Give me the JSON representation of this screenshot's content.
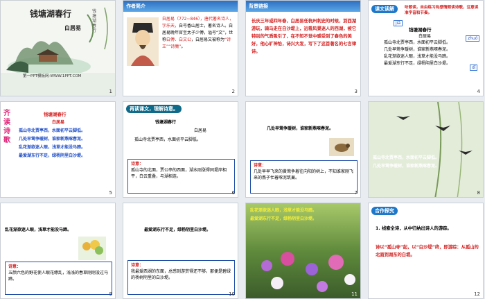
{
  "slides": [
    {
      "num": "1",
      "title": "钱塘湖春行",
      "subtitle": "白居易",
      "vertical": "钱塘湖春行",
      "footer": "第一PPT模板网-WWW.1PPT.COM"
    },
    {
      "num": "2",
      "header": "作者简介",
      "text_parts": [
        {
          "t": "白居易（772~846），",
          "c": "red"
        },
        {
          "t": "唐代著名诗人，",
          "c": ""
        },
        {
          "t": "字乐天，",
          "c": "red"
        },
        {
          "t": "自号香山居士，",
          "c": ""
        },
        {
          "t": "著名诗人。",
          "c": ""
        },
        {
          "t": "白居易晚年官至太子少傅，谥号“文”，世称",
          "c": ""
        },
        {
          "t": "白傅、白文公",
          "c": "red"
        },
        {
          "t": "，白居易又被称为",
          "c": ""
        },
        {
          "t": "“诗王”“诗魔”",
          "c": "red"
        },
        {
          "t": "。",
          "c": ""
        }
      ]
    },
    {
      "num": "3",
      "header": "背景链接",
      "text": "长庆三年或四年春，白居易任杭州刺史的时候，到西湖游玩，骑马走在白沙堤上，远看风景迷人的西湖，被它特别的气质吸引了，在不知不觉中感受到了春色的美好，他心旷神怡，诗兴大发，写下了这首著名的七言律诗。"
    },
    {
      "num": "4",
      "header": "课文读解",
      "instruction": "听朗读，自由练习有感情朗读诗歌，注意读准字音和节奏。",
      "pinyin": [
        "jiǎ",
        "zhuó",
        "dī"
      ],
      "poem_title": "钱塘湖春行",
      "author": "白居易",
      "lines": [
        "孤山寺北贾亭西，水面初平云脚低。",
        "几处早莺争暖树，谁家新燕啄春泥。",
        "乱花渐欲迷人眼，浅草才能没马蹄。",
        "最爱湖东行不足，绿杨阴里白沙堤。"
      ]
    },
    {
      "num": "5",
      "side": "齐读诗歌",
      "poem_title": "钱塘湖春行",
      "author": "白居易",
      "lines": [
        "孤山寺北贾亭西，水面初平云脚低。",
        "几处早莺争暖树，谁家新燕啄春泥。",
        "乱花渐欲迷人眼，浅草才能没马蹄。",
        "最爱湖东行不足，绿杨阴里白沙堤。"
      ]
    },
    {
      "num": "6",
      "header": "再读课文，理解诗意。",
      "poem_title": "钱塘湖春行",
      "author": "白居易",
      "line": "孤山寺北贾亭西，水面初平云脚低。",
      "note_label": "诗意：",
      "note": "孤山寺的北面，贾公亭的西面，湖水刚涨得同堤岸相平，白云重叠，与湖相连。"
    },
    {
      "num": "7",
      "line": "几处早莺争暖树，谁家新燕啄春泥。",
      "note_label": "诗意：",
      "note": "几处早早飞来的黄莺争着往向阳的树上，不知谁家刚飞来的燕子忙着啄泥筑巢。"
    },
    {
      "num": "8",
      "lines": [
        "孤山寺北贾亭西，水面初平云脚低。",
        "几处早莺争暖树，谁家新燕啄春泥。"
      ]
    },
    {
      "num": "9",
      "line": "乱花渐欲迷人眼，浅草才能没马蹄。",
      "note_label": "诗意：",
      "note": "五颜六色的野花使人眼花缭乱，浅浅的春草刚刚没过马蹄。"
    },
    {
      "num": "10",
      "line": "最爱湖东行不足，绿杨阴里白沙堤。",
      "note_label": "诗意：",
      "note": "我最爱西湖的东面，总感到游赏得还不够，那便是碧绿的杨树阴里的白沙堤。"
    },
    {
      "num": "11",
      "lines": [
        "乱花渐欲迷人眼，浅草才能没马蹄。",
        "最爱湖东行不足，绿杨阴里白沙堤。"
      ]
    },
    {
      "num": "12",
      "header": "合作探究",
      "question": "1. 线索全诗，从中归纳出诗人的游踪。",
      "answer": "诗以“孤山寺”起，以“白沙堤”终，即游踪：从孤山的北面到湖东的白堤。"
    }
  ]
}
